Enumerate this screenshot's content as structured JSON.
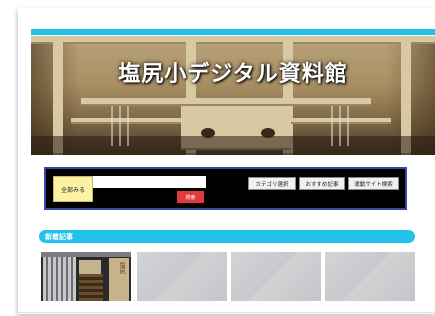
{
  "site": {
    "title": "塩尻小デジタル資料館"
  },
  "search_panel": {
    "all_view_label": "全部みる",
    "search_input_value": "",
    "search_button_label": "検索",
    "nav_buttons": [
      "カテゴリ選択",
      "おすすめ記事",
      "運動サイト検索"
    ]
  },
  "new_articles": {
    "heading": "新着記事",
    "cards": [
      {
        "type": "photo",
        "sign_text": "塩尻"
      },
      {
        "type": "placeholder"
      },
      {
        "type": "placeholder"
      },
      {
        "type": "placeholder"
      }
    ]
  },
  "colors": {
    "accent": "#22c3ea",
    "panel_bg": "#000000",
    "panel_border": "#3b45a8",
    "search_button": "#e23a3a",
    "all_view_bg": "#fbf2a4"
  }
}
